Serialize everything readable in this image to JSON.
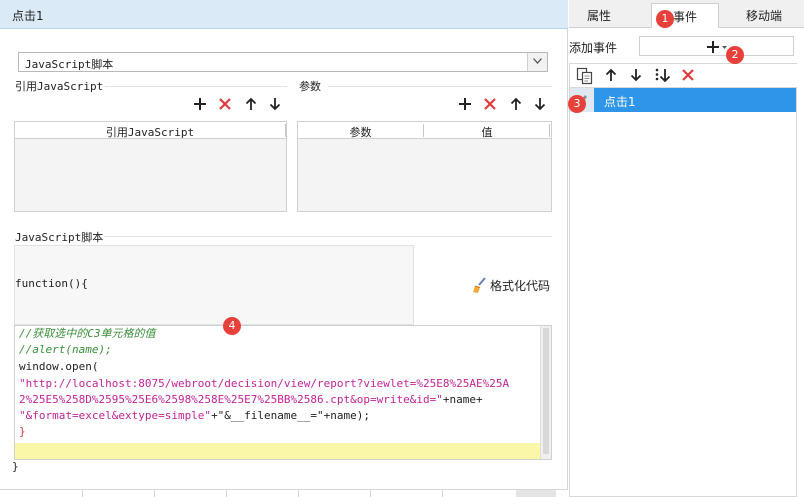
{
  "editor": {
    "title": "点击1",
    "script_type": "JavaScript脚本",
    "ref_js_group": "引用JavaScript",
    "params_group": "参数",
    "ref_js_column": "引用JavaScript",
    "param_columns": [
      "参数",
      "值"
    ],
    "script_group": "JavaScript脚本",
    "function_header": "function(){",
    "function_footer": "}",
    "format_code_label": "格式化代码",
    "code_lines": [
      "//获取选中的C3单元格的值",
      "//alert(name);",
      "window.open(",
      "\"http://localhost:8075/webroot/decision/view/report?viewlet=%25E8%25AE%25A",
      "2%25E5%258D%2595%25E6%2598%258E%25E7%25BB%2586.cpt&op=write&id=\"",
      "\"&format=excel&extype=simple\"",
      "}"
    ],
    "code_line_tails": [
      "+name+",
      "+\"&__filename__=\"+name);"
    ]
  },
  "right_panel": {
    "tabs": [
      "属性",
      "事件",
      "移动端"
    ],
    "active_tab": "事件",
    "add_event_label": "添加事件",
    "events": [
      "点击1"
    ]
  },
  "markers": [
    "1",
    "2",
    "3",
    "4"
  ],
  "colors": {
    "title_bar": "#dbeaf7",
    "selected_row": "#2e95e8",
    "delete_red": "#e03a3a",
    "marker_red": "#e8413b",
    "highlight_line": "#fbf7a9"
  }
}
